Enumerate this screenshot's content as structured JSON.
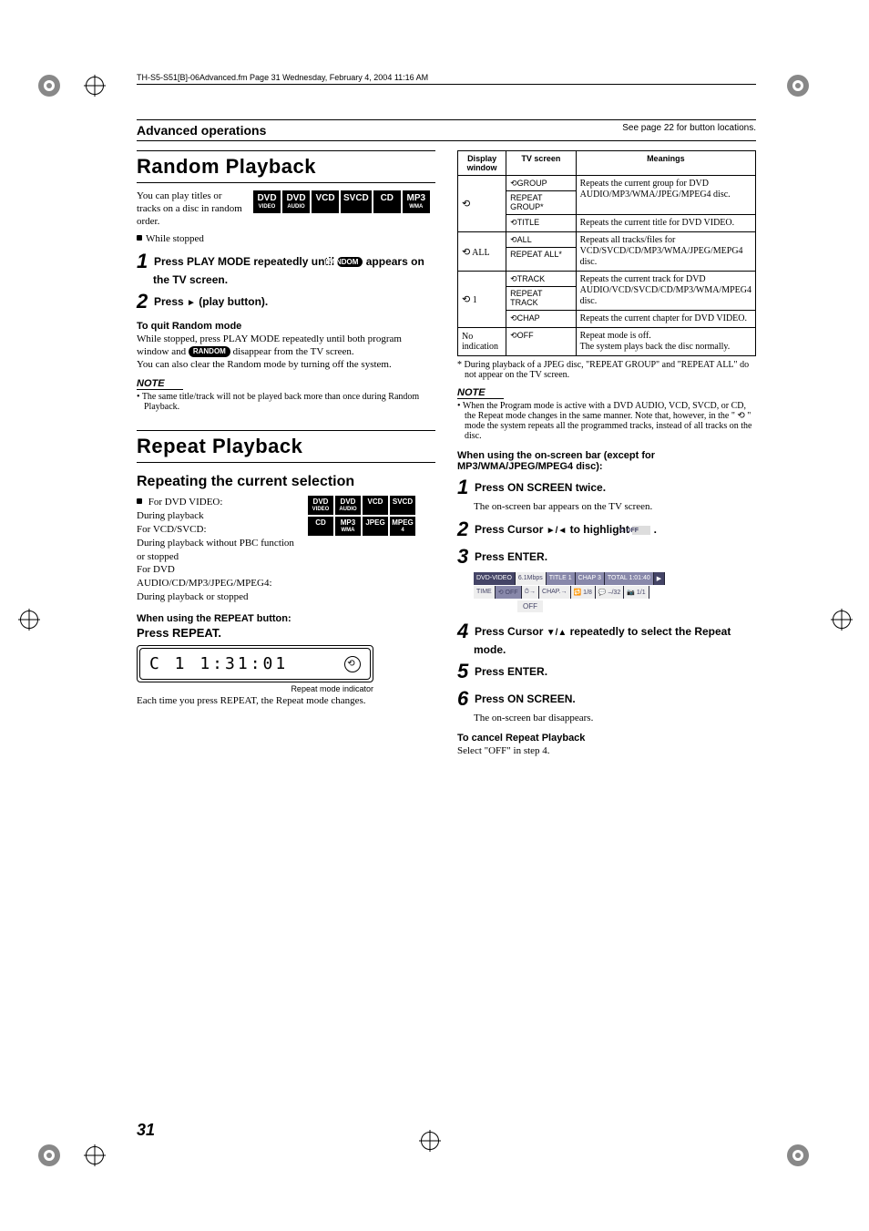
{
  "header_line": "TH-S5-S51[B]-06Advanced.fm  Page 31  Wednesday, February 4, 2004  11:16 AM",
  "section_header": "Advanced operations",
  "see_page": "See page 22 for button locations.",
  "random": {
    "title": "Random Playback",
    "intro": "You can play titles or tracks on a disc in random order.",
    "badges": [
      "DVD|VIDEO",
      "DVD|AUDIO",
      "VCD",
      "SVCD",
      "CD",
      "MP3|WMA"
    ],
    "while_stopped": "While stopped",
    "step1": "Press PLAY MODE repeatedly until ",
    "step1b": " appears on the TV screen.",
    "random_pill": "RANDOM",
    "step2": "Press ",
    "step2_tri": "►",
    "step2b": " (play button).",
    "quit_h": "To quit Random mode",
    "quit_body1": "While stopped, press PLAY MODE repeatedly until both program window and ",
    "quit_body2": " disappear from the TV screen.",
    "quit_body3": "You can also clear the Random mode by turning off the system.",
    "note_h": "NOTE",
    "note_body": "The same title/track will not be played back more than once during Random Playback."
  },
  "repeat": {
    "title": "Repeat Playback",
    "subtitle": "Repeating the current selection",
    "ctx_lines": [
      "For DVD VIDEO:",
      "During playback",
      "For VCD/SVCD:",
      "During playback without PBC function or stopped",
      "For DVD AUDIO/CD/MP3/JPEG/MPEG4:",
      "During playback or stopped"
    ],
    "badges": [
      "DVD|VIDEO",
      "DVD|AUDIO",
      "VCD",
      "SVCD",
      "CD",
      "MP3|WMA",
      "JPEG",
      "MPEG|4"
    ],
    "when_using": "When using the REPEAT button:",
    "press_repeat": "Press REPEAT.",
    "lcd_text": "C  1  1:31:01",
    "lcd_caption": "Repeat mode indicator",
    "caption2": "Each time you press REPEAT, the Repeat mode changes."
  },
  "table": {
    "headers": [
      "Display window",
      "TV screen",
      "Meanings"
    ],
    "rows": [
      {
        "disp": "⟲",
        "disp_extra": "",
        "tv": "⟲GROUP\nREPEAT GROUP*",
        "mean": "Repeats the current group for DVD AUDIO/MP3/WMA/JPEG/MPEG4 disc."
      },
      {
        "disp": "",
        "disp_extra": "",
        "tv": "⟲TITLE",
        "mean": "Repeats the current title for DVD VIDEO."
      },
      {
        "disp": "⟲ ALL",
        "disp_extra": "",
        "tv": "⟲ALL\nREPEAT ALL*",
        "mean": "Repeats all tracks/files for VCD/SVCD/CD/MP3/WMA/JPEG/MEPG4 disc."
      },
      {
        "disp": "⟲ 1",
        "disp_extra": "",
        "tv": "⟲TRACK\nREPEAT TRACK",
        "mean": "Repeats the current track for DVD AUDIO/VCD/SVCD/CD/MP3/WMA/MPEG4 disc."
      },
      {
        "disp": "",
        "disp_extra": "",
        "tv": "⟲CHAP",
        "mean": "Repeats the current chapter for DVD VIDEO."
      },
      {
        "disp": "No indication",
        "disp_extra": "",
        "tv": "⟲OFF",
        "mean": "Repeat mode is off.\nThe system plays back the disc normally."
      }
    ],
    "footnote": "* During playback of a JPEG disc, \"REPEAT GROUP\" and \"REPEAT ALL\" do not appear on the TV screen.",
    "note_h": "NOTE",
    "note_body": "When the Program mode is active with a DVD AUDIO, VCD, SVCD, or CD, the Repeat mode changes in the same manner. Note that, however, in the \" ⟲ \" mode the system repeats all the programmed tracks, instead of all tracks on the disc."
  },
  "osb": {
    "heading": "When using the on-screen bar (except for MP3/WMA/JPEG/MPEG4 disc):",
    "s1": "Press ON SCREEN twice.",
    "s1b": "The on-screen bar appears on the TV screen.",
    "s2a": "Press Cursor ",
    "s2_tri": "►/◄",
    "s2b": " to highlight ",
    "s2_off": "⟲ OFF",
    "s2c": " .",
    "s3": "Press ENTER.",
    "bar1": [
      "DVD-VIDEO",
      "6.1Mbps",
      "TITLE 1",
      "CHAP 3",
      "TOTAL 1:01:40",
      "▶"
    ],
    "bar2": [
      "TIME",
      "⟲ OFF",
      "⏱→",
      "CHAP.→",
      "🔁 1/8",
      "💬 –/32",
      "📷 1/1"
    ],
    "off_label": "OFF",
    "s4a": "Press Cursor ",
    "s4_tri": "▼/▲",
    "s4b": " repeatedly to select the Repeat mode.",
    "s5": "Press ENTER.",
    "s6": "Press ON SCREEN.",
    "s6b": "The on-screen bar disappears.",
    "cancel_h": "To cancel Repeat Playback",
    "cancel_b": "Select \"OFF\" in step 4."
  },
  "page_number": "31"
}
